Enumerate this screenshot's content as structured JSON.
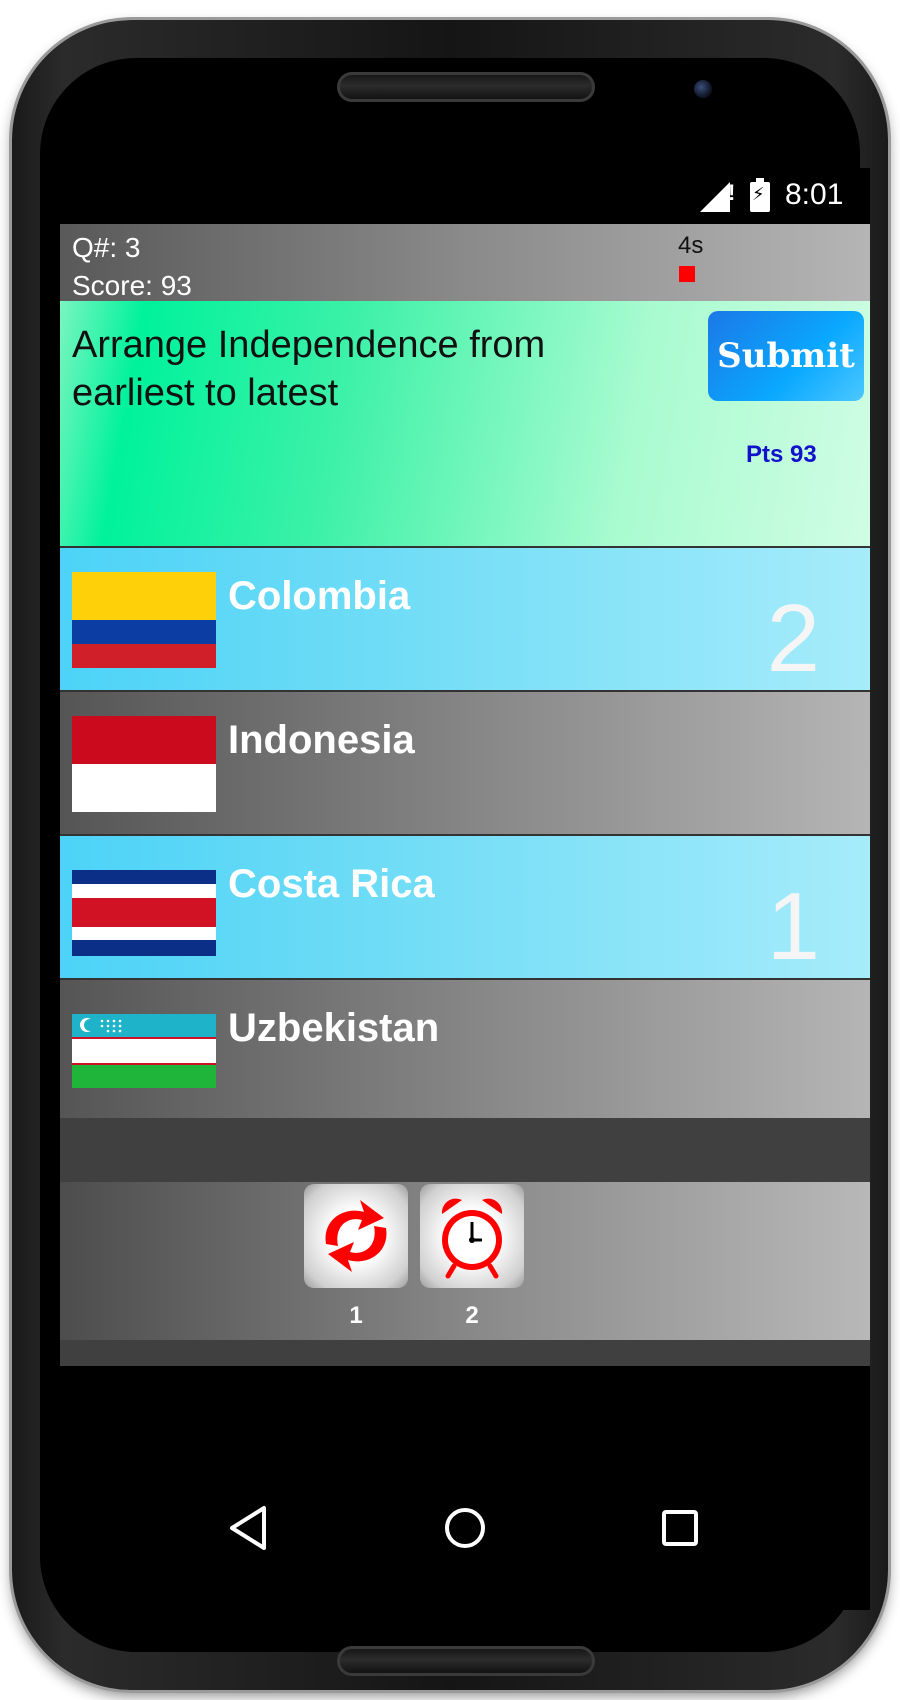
{
  "status_bar": {
    "time": "8:01",
    "signal_alert": "!"
  },
  "info_bar": {
    "question_number": "Q#: 3",
    "score": "Score: 93",
    "timer": "4s"
  },
  "question": {
    "text": "Arrange Independence from earliest to latest",
    "submit_label": "Submit",
    "points": "Pts 93"
  },
  "answers": [
    {
      "country": "Colombia",
      "rank": "2",
      "selected": true,
      "flag": "colombia-flag-icon"
    },
    {
      "country": "Indonesia",
      "rank": "",
      "selected": false,
      "flag": "indonesia-flag-icon"
    },
    {
      "country": "Costa Rica",
      "rank": "1",
      "selected": true,
      "flag": "costa-rica-flag-icon"
    },
    {
      "country": "Uzbekistan",
      "rank": "",
      "selected": false,
      "flag": "uzbekistan-flag-icon"
    }
  ],
  "lifelines": [
    {
      "icon": "refresh-icon",
      "count": "1"
    },
    {
      "icon": "alarm-clock-icon",
      "count": "2"
    }
  ],
  "colors": {
    "selected_row": "#4cd3f7",
    "question_bg": "#00f29b",
    "submit_bg": "#0aa8ff",
    "points_text": "#1212cc",
    "timer_indicator": "#ff0000",
    "lifeline_icon": "#ff0000"
  }
}
